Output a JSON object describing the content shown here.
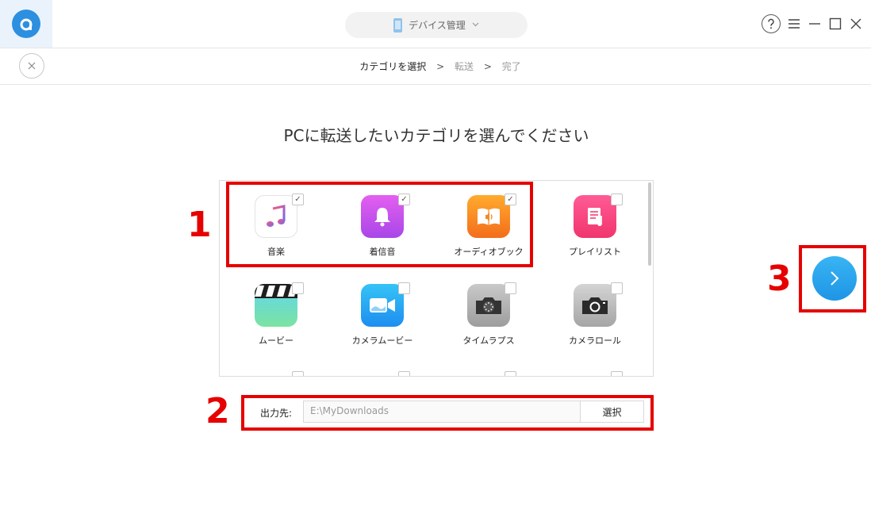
{
  "header": {
    "device_selector": "デバイス管理"
  },
  "stepbar": {
    "steps": [
      "カテゴリを選択",
      "転送",
      "完了"
    ],
    "separator": ">"
  },
  "main": {
    "heading": "PCに転送したいカテゴリを選んでください",
    "categories": [
      {
        "label": "音楽",
        "checked": true,
        "icon": "music-icon"
      },
      {
        "label": "着信音",
        "checked": true,
        "icon": "ringtone-bell-icon"
      },
      {
        "label": "オーディオブック",
        "checked": true,
        "icon": "audiobook-icon"
      },
      {
        "label": "プレイリスト",
        "checked": false,
        "icon": "playlist-icon"
      },
      {
        "label": "ムービー",
        "checked": false,
        "icon": "movie-clapper-icon"
      },
      {
        "label": "カメラムービー",
        "checked": false,
        "icon": "video-camera-icon"
      },
      {
        "label": "タイムラプス",
        "checked": false,
        "icon": "timelapse-camera-icon"
      },
      {
        "label": "カメラロール",
        "checked": false,
        "icon": "camera-icon"
      }
    ],
    "check_mark": "✓"
  },
  "output": {
    "label": "出力先:",
    "path": "E:\\MyDownloads",
    "select_button": "選択"
  },
  "annotations": [
    "1",
    "2",
    "3"
  ],
  "colors": {
    "accent": "#1e95e6",
    "annotation": "#e60000"
  }
}
